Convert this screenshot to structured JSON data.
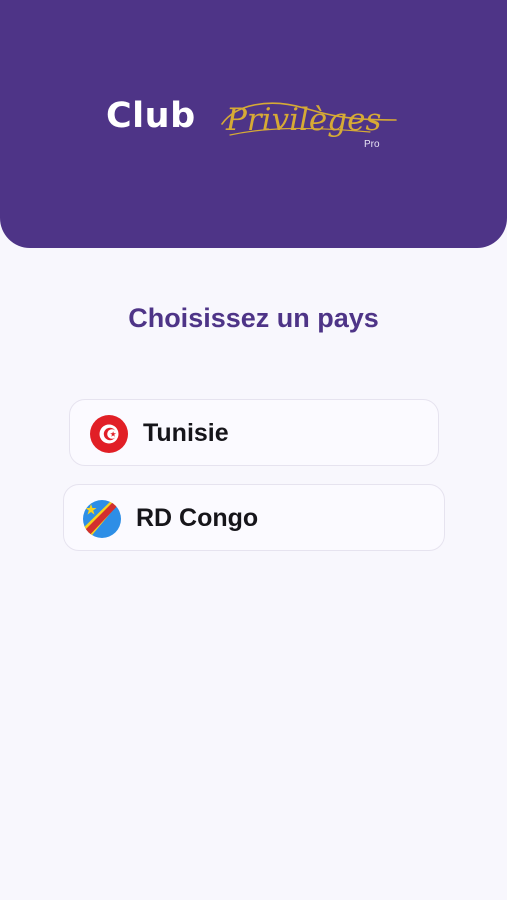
{
  "header": {
    "logo": {
      "club_text": "Club",
      "script_text": "Privilèges",
      "pro_text": "Pro"
    }
  },
  "main": {
    "title": "Choisissez un pays",
    "countries": [
      {
        "label": "Tunisie",
        "flag_icon": "tunisia-flag-icon"
      },
      {
        "label": "RD Congo",
        "flag_icon": "dr-congo-flag-icon"
      }
    ]
  },
  "colors": {
    "brand_purple": "#4e3487",
    "gold_script": "#d6aa35",
    "page_background": "#f8f7fd"
  }
}
